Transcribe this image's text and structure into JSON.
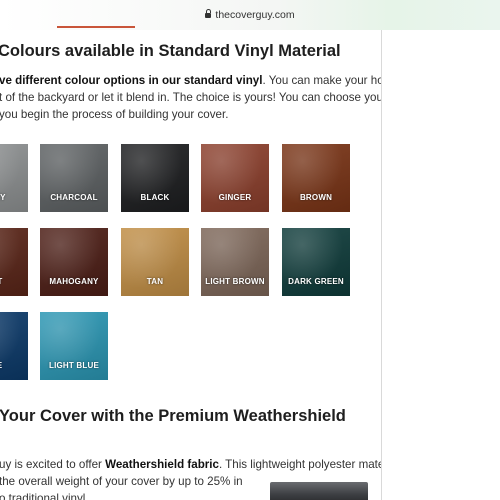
{
  "browser": {
    "url": "thecoverguy.com"
  },
  "section1": {
    "heading": "Colours available in Standard Vinyl Material",
    "lines": [
      {
        "bold": "ve different colour options in our standard vinyl",
        "rest": ". You can make your hot tub"
      },
      {
        "bold": "",
        "rest": "t of the backyard or let it blend in. The choice is yours! You can choose your"
      },
      {
        "bold": "",
        "rest": "you begin the process of building your cover."
      }
    ]
  },
  "swatches": [
    {
      "label": "GREY",
      "color": "#8e9192"
    },
    {
      "label": "CHARCOAL",
      "color": "#5d6163"
    },
    {
      "label": "BLACK",
      "color": "#1d1e20"
    },
    {
      "label": "GINGER",
      "color": "#8c3f2c"
    },
    {
      "label": "BROWN",
      "color": "#7a3416"
    },
    {
      "label": "NUT",
      "color": "#5a2518"
    },
    {
      "label": "MAHOGANY",
      "color": "#4d1e16"
    },
    {
      "label": "TAN",
      "color": "#c18e45"
    },
    {
      "label": "LIGHT BROWN",
      "color": "#7d6658"
    },
    {
      "label": "DARK GREEN",
      "color": "#0f3c3b"
    },
    {
      "label": "LUE",
      "color": "#0c3a6a"
    },
    {
      "label": "LIGHT BLUE",
      "color": "#2b97b4"
    }
  ],
  "section2": {
    "heading": "Your Cover with the Premium Weathershield",
    "lines": [
      {
        "pre": "uy is excited to offer ",
        "bold": "Weathershield fabric",
        "post": ". This lightweight polyester material"
      },
      {
        "pre": "the overall weight of your cover by up to 25% in",
        "bold": "",
        "post": ""
      },
      {
        "pre": "o traditional vinyl.",
        "bold": "",
        "post": ""
      }
    ]
  }
}
